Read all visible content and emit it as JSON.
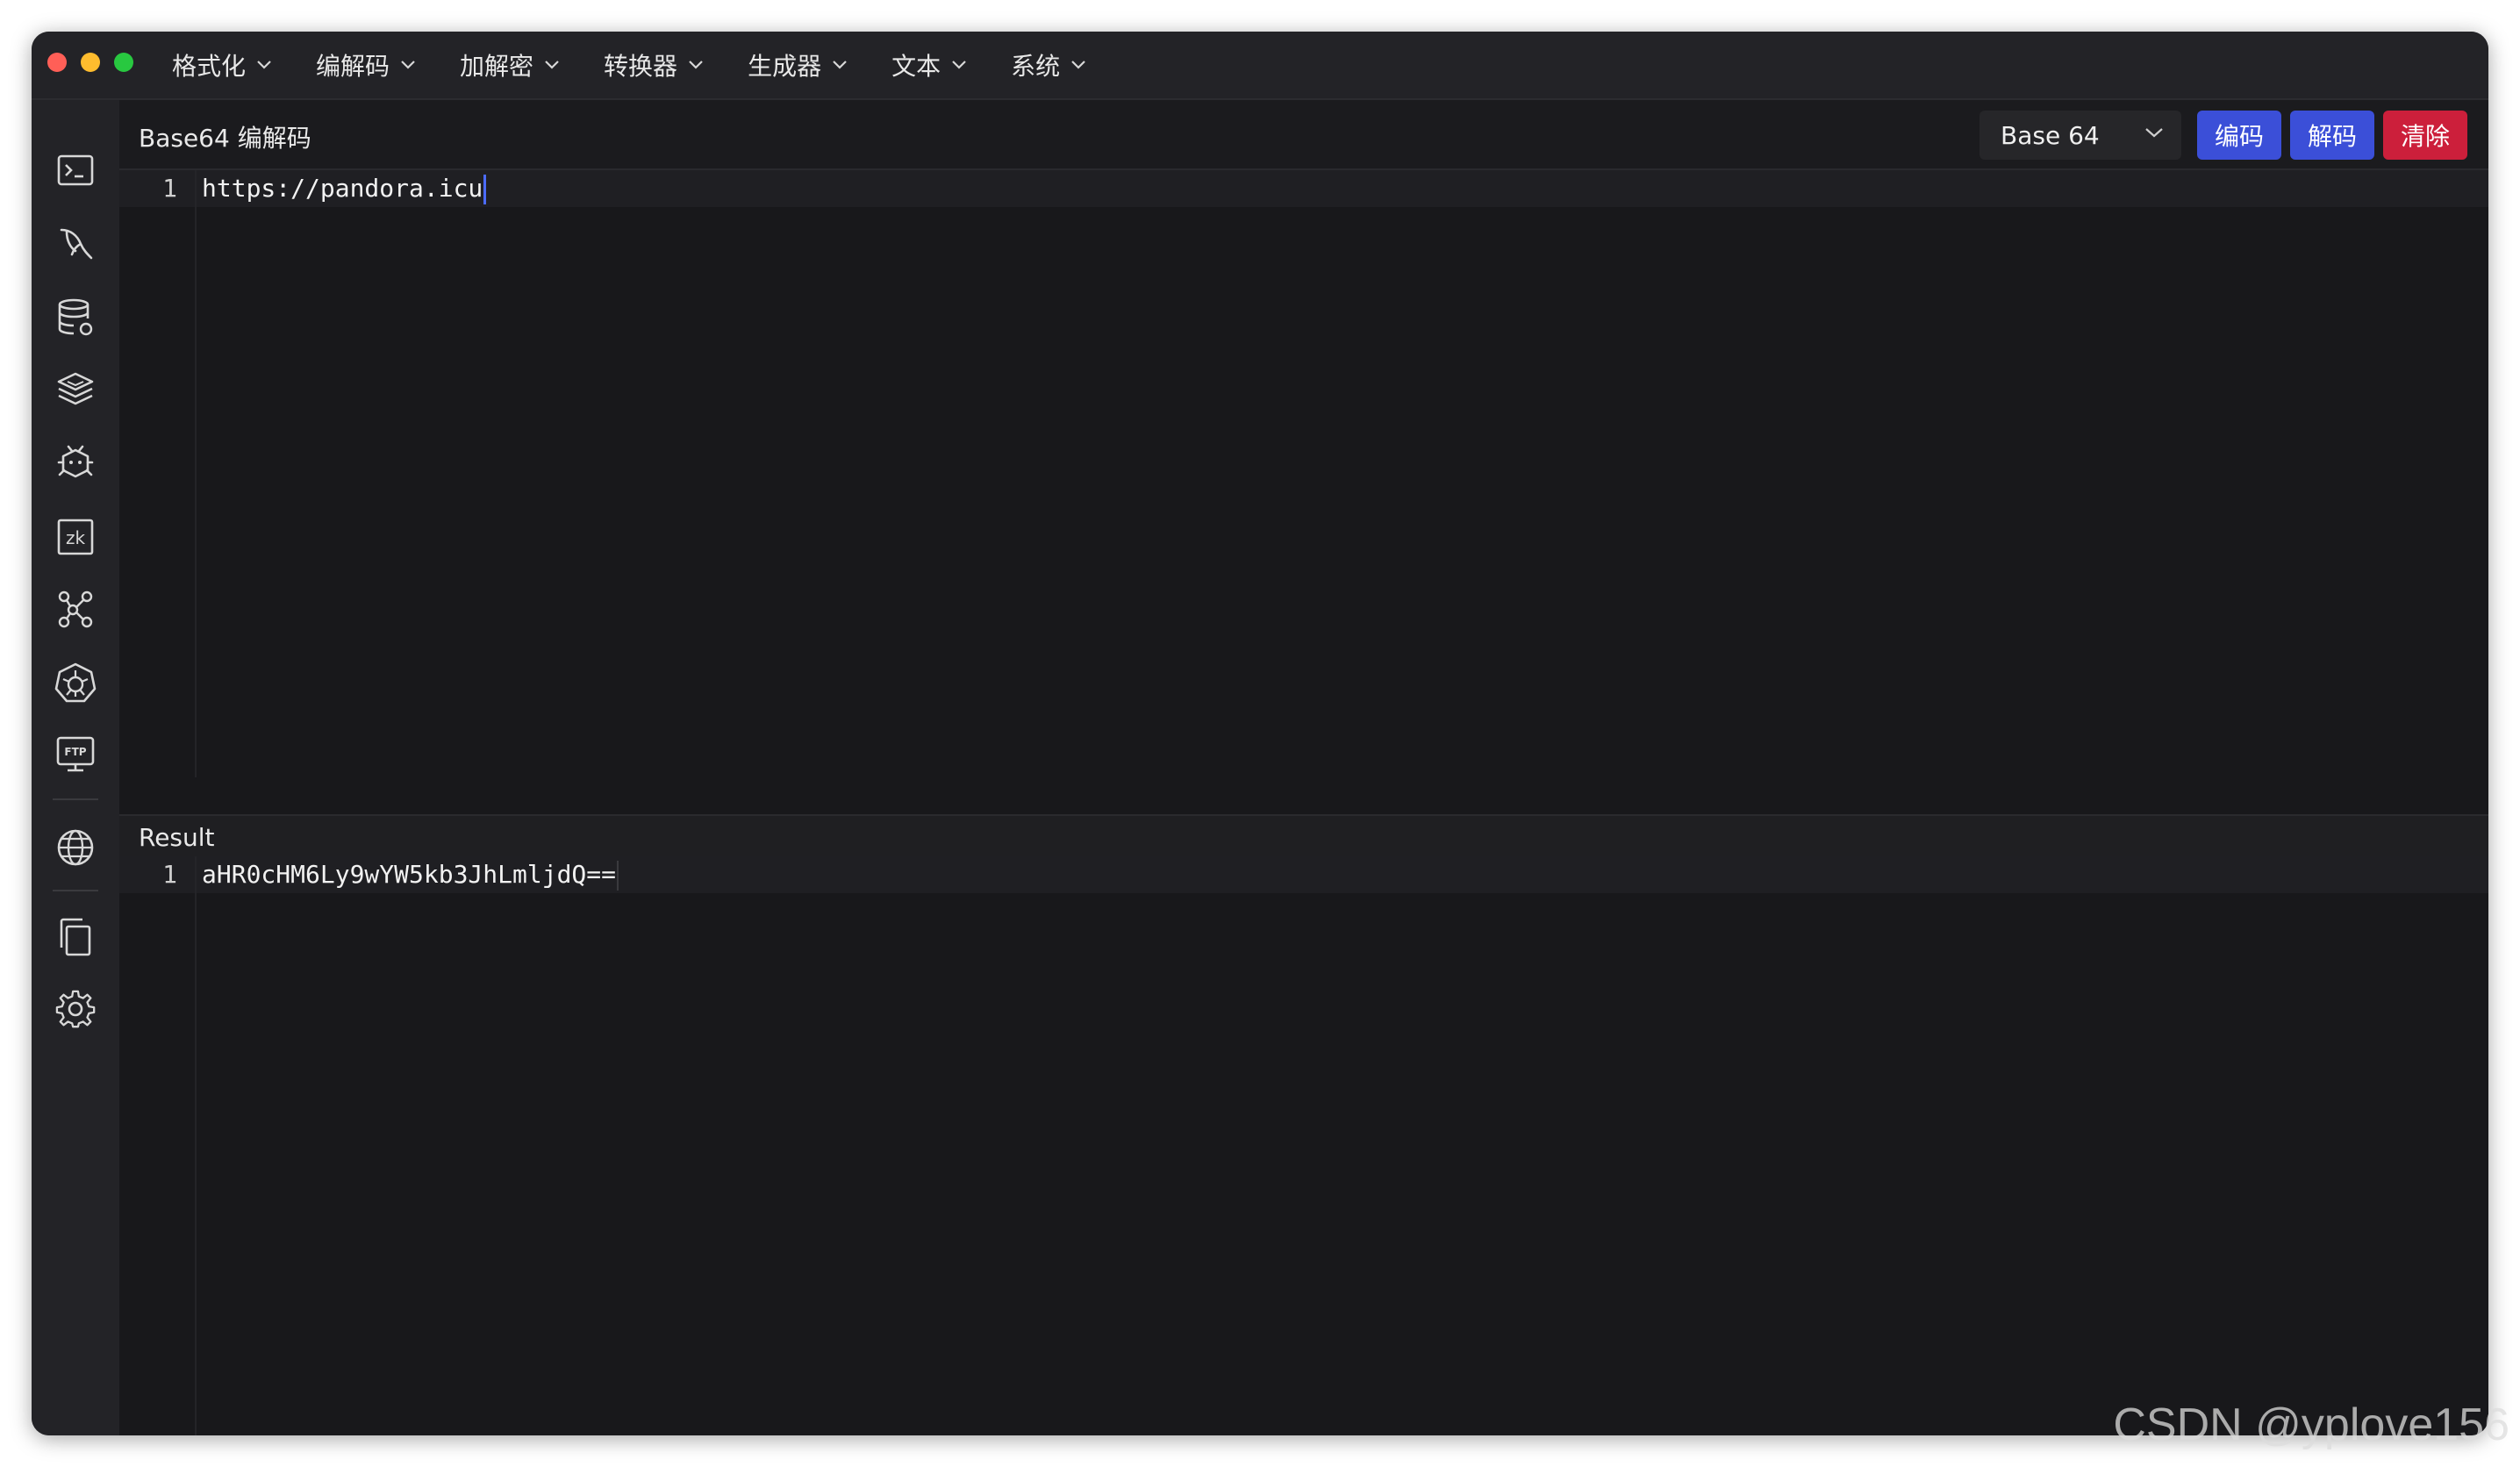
{
  "menu": [
    {
      "label": "格式化"
    },
    {
      "label": "编解码"
    },
    {
      "label": "加解密"
    },
    {
      "label": "转换器"
    },
    {
      "label": "生成器"
    },
    {
      "label": "文本"
    },
    {
      "label": "系统"
    }
  ],
  "sidebar": {
    "icons": [
      "terminal-icon",
      "mysql-icon",
      "database-icon",
      "layers-icon",
      "bug-icon",
      "zookeeper-icon",
      "network-icon",
      "kubernetes-icon",
      "ftp-icon",
      "globe-icon",
      "copy-icon",
      "gear-icon"
    ],
    "zk_label": "zk",
    "ftp_label": "FTP"
  },
  "toolbar": {
    "title": "Base64 编解码",
    "select_value": "Base 64",
    "encode_label": "编码",
    "decode_label": "解码",
    "clear_label": "清除"
  },
  "input_editor": {
    "line_number": "1",
    "text": "https://pandora.icu"
  },
  "result": {
    "label": "Result",
    "line_number": "1",
    "text": "aHR0cHM6Ly9wYW5kb3JhLmljdQ=="
  },
  "watermark": "CSDN @yplove156",
  "colors": {
    "accent": "#3b4fd8",
    "danger": "#cc1f3b",
    "background": "#18181b"
  }
}
